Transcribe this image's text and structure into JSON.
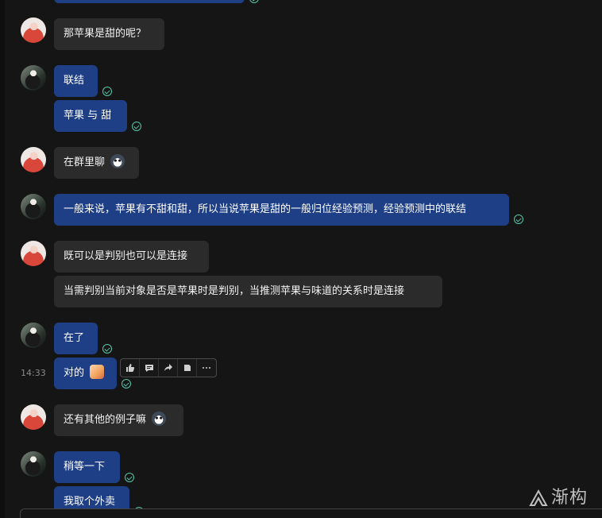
{
  "messages": {
    "m1": "那苹果是甜的呢？",
    "m2": "联结",
    "m3": "苹果 与 甜",
    "m4": "在群里聊",
    "m5": "一般来说，苹果有不甜和甜，所以当说苹果是甜的一般归位经验预测，经验预测中的联结",
    "m6": "既可以是判别也可以是连接",
    "m7": "当需判别当前对象是否是苹果时是判别，当推测苹果与味道的关系时是连接",
    "m8": "在了",
    "m9": "对的",
    "m10": "还有其他的例子嘛",
    "m11": "稍等一下",
    "m12": "我取个外卖"
  },
  "timestamp": "14:33",
  "watermark": {
    "text": "渐构"
  },
  "icons": {
    "thumb": "thumb-up-icon",
    "comment": "comment-icon",
    "share": "share-icon",
    "sticker": "sticker-icon",
    "more": "more-icon",
    "read": "read-check-icon"
  },
  "colors": {
    "background": "#151515",
    "self_bubble": "#1e3f85",
    "other_bubble": "#2b2b2b",
    "read_check": "#54c7a8"
  }
}
